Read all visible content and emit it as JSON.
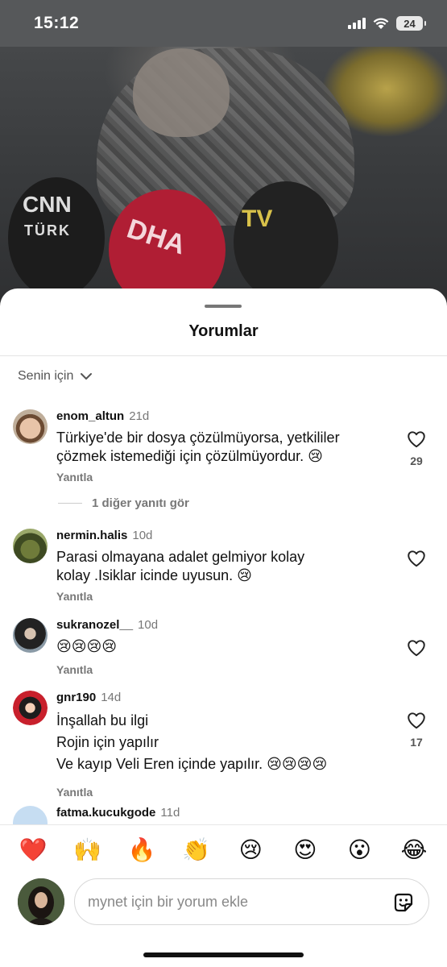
{
  "status_bar": {
    "time": "15:12",
    "battery": "24"
  },
  "video": {
    "mic_labels": [
      "CNN",
      "TÜRK",
      "DHA",
      "TV"
    ]
  },
  "sheet": {
    "title": "Yorumlar",
    "sort_label": "Senin için"
  },
  "comments": [
    {
      "username": "enom_altun",
      "time": "21d",
      "lines": [
        "Türkiye'de bir dosya çözülmüyorsa, yetkililer",
        "çözmek istemediği için çözülmüyordur. 😢"
      ],
      "reply_label": "Yanıtla",
      "likes": "29",
      "more_replies": "1 diğer yanıtı gör"
    },
    {
      "username": "nermin.halis",
      "time": "10d",
      "lines": [
        "Parasi olmayana adalet gelmiyor kolay",
        "kolay .Isiklar icinde uyusun. 😢"
      ],
      "reply_label": "Yanıtla",
      "likes": ""
    },
    {
      "username": "sukranozel__",
      "time": "10d",
      "lines": [
        "😢😢😢😢"
      ],
      "reply_label": "Yanıtla",
      "likes": ""
    },
    {
      "username": "gnr190",
      "time": "14d",
      "lines": [
        "İnşallah bu ilgi",
        "Rojin için yapılır",
        "Ve kayıp Veli Eren içinde yapılır. 😢😢😢😢"
      ],
      "reply_label": "Yanıtla",
      "likes": "17"
    },
    {
      "username": "fatma.kucukgode",
      "time": "11d",
      "lines": [],
      "reply_label": "",
      "likes": ""
    }
  ],
  "emoji_bar": [
    "❤️",
    "🙌",
    "🔥",
    "👏",
    "😢",
    "😍",
    "😮",
    "😂"
  ],
  "composer": {
    "placeholder": "mynet için bir yorum ekle"
  },
  "colors": {
    "heart_outline": "#222222",
    "muted_text": "#777777",
    "sheet_bg": "#ffffff"
  },
  "icons": [
    "wifi-icon",
    "signal-icon",
    "battery-icon",
    "chevron-down-icon",
    "heart-icon",
    "sticker-icon"
  ]
}
